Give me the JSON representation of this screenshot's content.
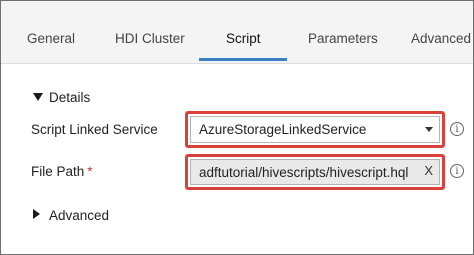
{
  "tabs": [
    {
      "label": "General"
    },
    {
      "label": "HDI Cluster"
    },
    {
      "label": "Script",
      "active": true
    },
    {
      "label": "Parameters"
    },
    {
      "label": "Advanced"
    }
  ],
  "sections": {
    "details": {
      "label": "Details",
      "expanded": true
    },
    "advanced": {
      "label": "Advanced",
      "expanded": false
    }
  },
  "fields": {
    "script_linked_service": {
      "label": "Script Linked Service",
      "value": "AzureStorageLinkedService",
      "info_icon": "info-icon"
    },
    "file_path": {
      "label": "File Path",
      "required_marker": "*",
      "value": "adftutorial/hivescripts/hivescript.hql",
      "clear_label": "X",
      "info_icon": "info-icon"
    }
  },
  "colors": {
    "highlight": "#d9413a",
    "active_tab_underline": "#3b7fc4",
    "required": "#d13438"
  }
}
